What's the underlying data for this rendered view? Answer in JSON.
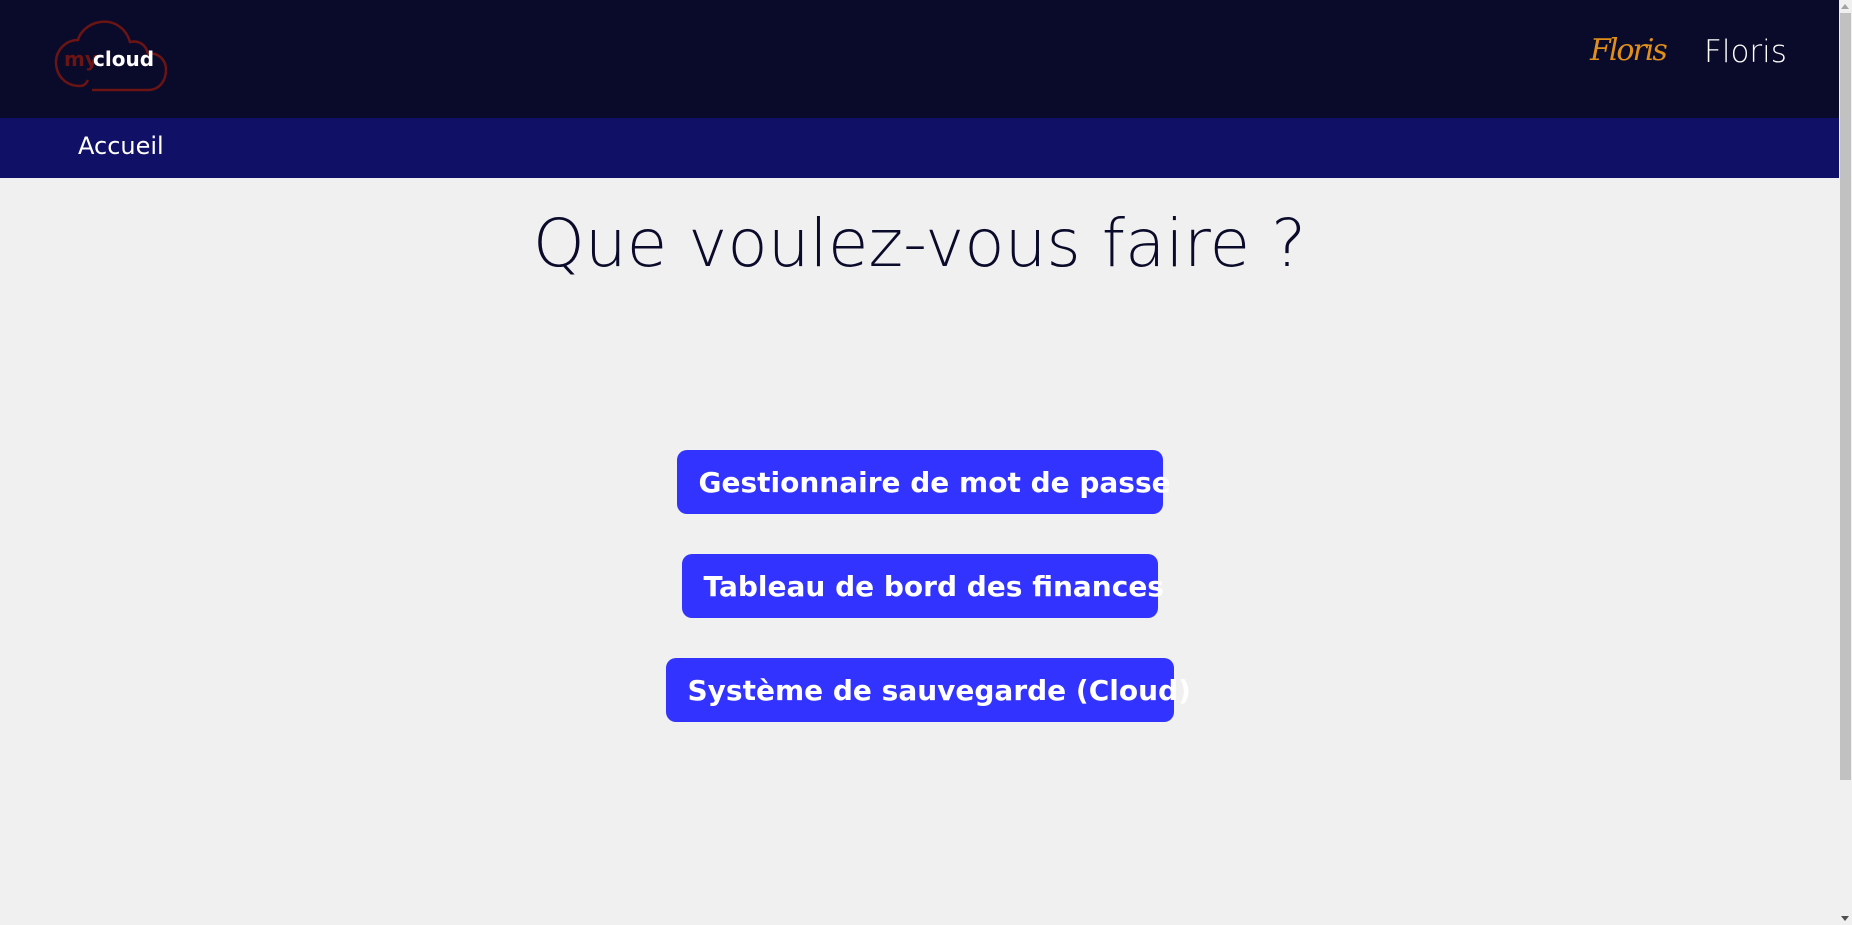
{
  "header": {
    "logo_text_my": "my",
    "logo_text_cloud": "cloud",
    "signature": "Floris",
    "username": "Floris"
  },
  "nav": {
    "items": [
      {
        "label": "Accueil"
      }
    ]
  },
  "main": {
    "title": "Que voulez-vous faire ?",
    "buttons": [
      {
        "label": "Gestionnaire de mot de passe"
      },
      {
        "label": "Tableau de bord des finances"
      },
      {
        "label": "Système de sauvegarde (Cloud)"
      }
    ]
  },
  "colors": {
    "header_bg": "#0a0a2a",
    "nav_bg": "#101066",
    "button_bg": "#3333ff",
    "logo_red": "#6b1414",
    "signature": "#e0901a"
  }
}
